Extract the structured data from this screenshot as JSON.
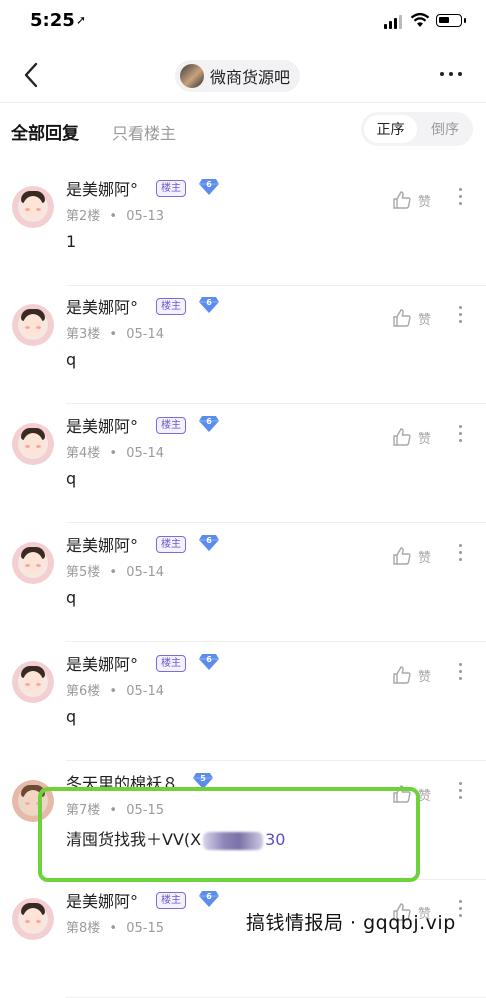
{
  "status_bar": {
    "time": "5:25",
    "location_arrow": "location-arrow-icon"
  },
  "navbar": {
    "forum_name": "微商货源吧"
  },
  "filter": {
    "all_replies": "全部回复",
    "owner_only": "只看楼主",
    "order_asc": "正序",
    "order_desc": "倒序"
  },
  "posts": [
    {
      "author": "是美娜阿°",
      "badge": "楼主",
      "level": "6",
      "floor": "第2楼",
      "date": "05-13",
      "content": "1",
      "like": "赞"
    },
    {
      "author": "是美娜阿°",
      "badge": "楼主",
      "level": "6",
      "floor": "第3楼",
      "date": "05-14",
      "content": "q",
      "like": "赞"
    },
    {
      "author": "是美娜阿°",
      "badge": "楼主",
      "level": "6",
      "floor": "第4楼",
      "date": "05-14",
      "content": "q",
      "like": "赞"
    },
    {
      "author": "是美娜阿°",
      "badge": "楼主",
      "level": "6",
      "floor": "第5楼",
      "date": "05-14",
      "content": "q",
      "like": "赞"
    },
    {
      "author": "是美娜阿°",
      "badge": "楼主",
      "level": "6",
      "floor": "第6楼",
      "date": "05-14",
      "content": "q",
      "like": "赞"
    },
    {
      "author": "冬天里的棉袄８",
      "badge": "",
      "level": "5",
      "floor": "第7楼",
      "date": "05-15",
      "content": "清囤货找我＋VV(X",
      "content_tail": "30",
      "like": "赞"
    },
    {
      "author": "是美娜阿°",
      "badge": "楼主",
      "level": "6",
      "floor": "第8楼",
      "date": "05-15",
      "content": "",
      "like": "赞"
    }
  ],
  "meta_separator": "•",
  "watermark": "搞钱情报局 · gqqbj.vip",
  "colors": {
    "badge": "#7b6cd9",
    "highlight": "#6fd23b",
    "level_gem": "#5b8def"
  }
}
